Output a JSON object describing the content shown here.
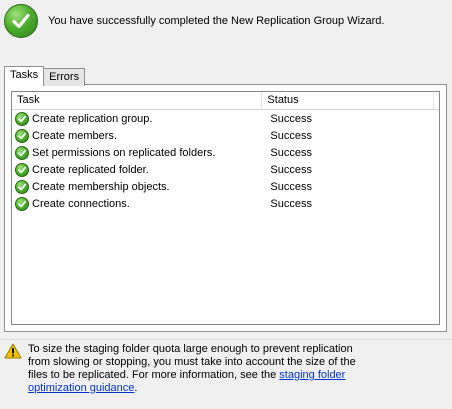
{
  "header": {
    "message": "You have successfully completed the New Replication Group Wizard.",
    "icon": "success-check-icon"
  },
  "tabs": [
    {
      "label": "Tasks",
      "active": true
    },
    {
      "label": "Errors",
      "active": false
    }
  ],
  "list": {
    "columns": [
      "Task",
      "Status"
    ],
    "rows": [
      {
        "task": "Create replication group.",
        "status": "Success"
      },
      {
        "task": "Create members.",
        "status": "Success"
      },
      {
        "task": "Set permissions on replicated folders.",
        "status": "Success"
      },
      {
        "task": "Create replicated folder.",
        "status": "Success"
      },
      {
        "task": "Create membership objects.",
        "status": "Success"
      },
      {
        "task": "Create connections.",
        "status": "Success"
      }
    ]
  },
  "footer": {
    "icon": "warning-icon",
    "text": "To size the staging folder quota large enough to prevent replication from slowing or stopping, you must take into account the size of the files to be replicated. For more information, see the ",
    "link_text": "staging folder optimization guidance",
    "text_end": "."
  },
  "colors": {
    "success_green": "#4caf2c",
    "link_blue": "#0033cc",
    "warning_yellow": "#f5c400"
  }
}
